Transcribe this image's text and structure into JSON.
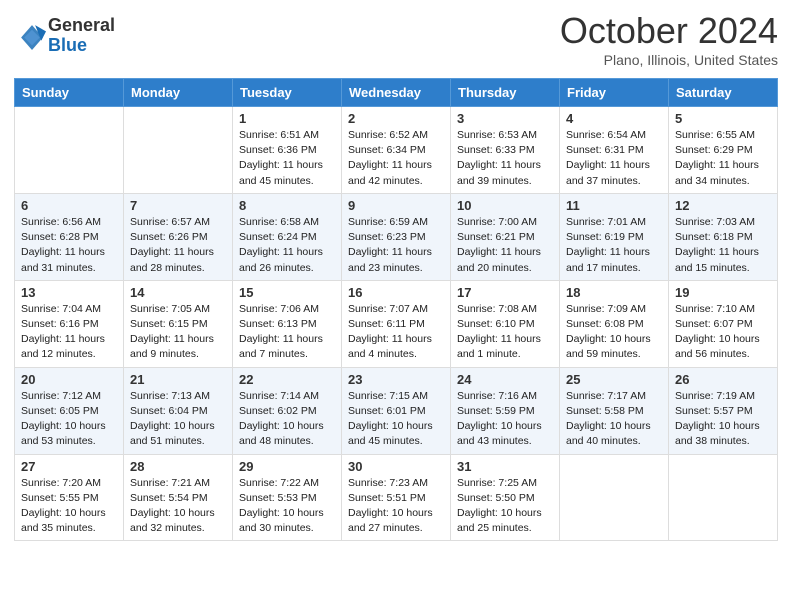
{
  "header": {
    "logo_general": "General",
    "logo_blue": "Blue",
    "title": "October 2024",
    "location": "Plano, Illinois, United States"
  },
  "columns": [
    "Sunday",
    "Monday",
    "Tuesday",
    "Wednesday",
    "Thursday",
    "Friday",
    "Saturday"
  ],
  "weeks": [
    [
      {
        "day": "",
        "info": ""
      },
      {
        "day": "",
        "info": ""
      },
      {
        "day": "1",
        "info": "Sunrise: 6:51 AM\nSunset: 6:36 PM\nDaylight: 11 hours and 45 minutes."
      },
      {
        "day": "2",
        "info": "Sunrise: 6:52 AM\nSunset: 6:34 PM\nDaylight: 11 hours and 42 minutes."
      },
      {
        "day": "3",
        "info": "Sunrise: 6:53 AM\nSunset: 6:33 PM\nDaylight: 11 hours and 39 minutes."
      },
      {
        "day": "4",
        "info": "Sunrise: 6:54 AM\nSunset: 6:31 PM\nDaylight: 11 hours and 37 minutes."
      },
      {
        "day": "5",
        "info": "Sunrise: 6:55 AM\nSunset: 6:29 PM\nDaylight: 11 hours and 34 minutes."
      }
    ],
    [
      {
        "day": "6",
        "info": "Sunrise: 6:56 AM\nSunset: 6:28 PM\nDaylight: 11 hours and 31 minutes."
      },
      {
        "day": "7",
        "info": "Sunrise: 6:57 AM\nSunset: 6:26 PM\nDaylight: 11 hours and 28 minutes."
      },
      {
        "day": "8",
        "info": "Sunrise: 6:58 AM\nSunset: 6:24 PM\nDaylight: 11 hours and 26 minutes."
      },
      {
        "day": "9",
        "info": "Sunrise: 6:59 AM\nSunset: 6:23 PM\nDaylight: 11 hours and 23 minutes."
      },
      {
        "day": "10",
        "info": "Sunrise: 7:00 AM\nSunset: 6:21 PM\nDaylight: 11 hours and 20 minutes."
      },
      {
        "day": "11",
        "info": "Sunrise: 7:01 AM\nSunset: 6:19 PM\nDaylight: 11 hours and 17 minutes."
      },
      {
        "day": "12",
        "info": "Sunrise: 7:03 AM\nSunset: 6:18 PM\nDaylight: 11 hours and 15 minutes."
      }
    ],
    [
      {
        "day": "13",
        "info": "Sunrise: 7:04 AM\nSunset: 6:16 PM\nDaylight: 11 hours and 12 minutes."
      },
      {
        "day": "14",
        "info": "Sunrise: 7:05 AM\nSunset: 6:15 PM\nDaylight: 11 hours and 9 minutes."
      },
      {
        "day": "15",
        "info": "Sunrise: 7:06 AM\nSunset: 6:13 PM\nDaylight: 11 hours and 7 minutes."
      },
      {
        "day": "16",
        "info": "Sunrise: 7:07 AM\nSunset: 6:11 PM\nDaylight: 11 hours and 4 minutes."
      },
      {
        "day": "17",
        "info": "Sunrise: 7:08 AM\nSunset: 6:10 PM\nDaylight: 11 hours and 1 minute."
      },
      {
        "day": "18",
        "info": "Sunrise: 7:09 AM\nSunset: 6:08 PM\nDaylight: 10 hours and 59 minutes."
      },
      {
        "day": "19",
        "info": "Sunrise: 7:10 AM\nSunset: 6:07 PM\nDaylight: 10 hours and 56 minutes."
      }
    ],
    [
      {
        "day": "20",
        "info": "Sunrise: 7:12 AM\nSunset: 6:05 PM\nDaylight: 10 hours and 53 minutes."
      },
      {
        "day": "21",
        "info": "Sunrise: 7:13 AM\nSunset: 6:04 PM\nDaylight: 10 hours and 51 minutes."
      },
      {
        "day": "22",
        "info": "Sunrise: 7:14 AM\nSunset: 6:02 PM\nDaylight: 10 hours and 48 minutes."
      },
      {
        "day": "23",
        "info": "Sunrise: 7:15 AM\nSunset: 6:01 PM\nDaylight: 10 hours and 45 minutes."
      },
      {
        "day": "24",
        "info": "Sunrise: 7:16 AM\nSunset: 5:59 PM\nDaylight: 10 hours and 43 minutes."
      },
      {
        "day": "25",
        "info": "Sunrise: 7:17 AM\nSunset: 5:58 PM\nDaylight: 10 hours and 40 minutes."
      },
      {
        "day": "26",
        "info": "Sunrise: 7:19 AM\nSunset: 5:57 PM\nDaylight: 10 hours and 38 minutes."
      }
    ],
    [
      {
        "day": "27",
        "info": "Sunrise: 7:20 AM\nSunset: 5:55 PM\nDaylight: 10 hours and 35 minutes."
      },
      {
        "day": "28",
        "info": "Sunrise: 7:21 AM\nSunset: 5:54 PM\nDaylight: 10 hours and 32 minutes."
      },
      {
        "day": "29",
        "info": "Sunrise: 7:22 AM\nSunset: 5:53 PM\nDaylight: 10 hours and 30 minutes."
      },
      {
        "day": "30",
        "info": "Sunrise: 7:23 AM\nSunset: 5:51 PM\nDaylight: 10 hours and 27 minutes."
      },
      {
        "day": "31",
        "info": "Sunrise: 7:25 AM\nSunset: 5:50 PM\nDaylight: 10 hours and 25 minutes."
      },
      {
        "day": "",
        "info": ""
      },
      {
        "day": "",
        "info": ""
      }
    ]
  ]
}
